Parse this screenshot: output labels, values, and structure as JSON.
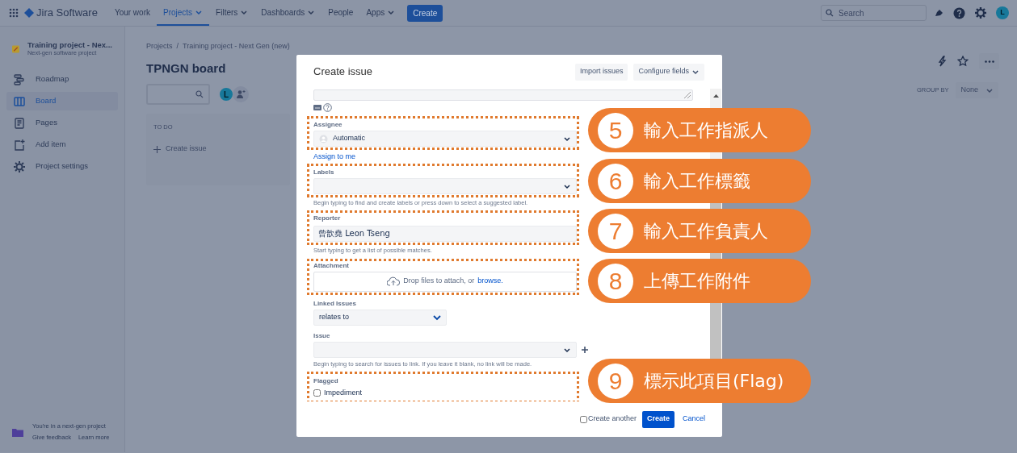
{
  "top_nav": {
    "product": "Jira Software",
    "items": [
      {
        "label": "Your work",
        "selected": false,
        "dropdown": false
      },
      {
        "label": "Projects",
        "selected": true,
        "dropdown": true
      },
      {
        "label": "Filters",
        "selected": false,
        "dropdown": true
      },
      {
        "label": "Dashboards",
        "selected": false,
        "dropdown": true
      },
      {
        "label": "People",
        "selected": false,
        "dropdown": false
      },
      {
        "label": "Apps",
        "selected": false,
        "dropdown": true
      }
    ],
    "create_button": "Create",
    "search": {
      "placeholder": "Search"
    },
    "avatar": "L"
  },
  "sidebar": {
    "project_name": "Training project - Nex...",
    "project_type": "Next-gen software project",
    "items": [
      {
        "label": "Roadmap",
        "selected": false
      },
      {
        "label": "Board",
        "selected": true
      },
      {
        "label": "Pages",
        "selected": false
      },
      {
        "label": "Add item",
        "selected": false
      },
      {
        "label": "Project settings",
        "selected": false
      }
    ],
    "footer": {
      "text": "You're in a next-gen project",
      "links": [
        "Give feedback",
        "Learn more"
      ]
    }
  },
  "board": {
    "breadcrumbs": [
      "Projects",
      "Training project - Next Gen (new)"
    ],
    "breadcrumb_separator": "/",
    "title": "TPNGN board",
    "avatar": "L",
    "group_by": {
      "label": "GROUP BY",
      "value": "None"
    },
    "columns": [
      {
        "title": "TO DO",
        "action": "Create issue"
      }
    ]
  },
  "modal": {
    "title": "Create issue",
    "header_buttons": [
      "Import issues",
      "Configure fields"
    ],
    "assignee": {
      "label": "Assignee",
      "value": "Automatic",
      "link": "Assign to me",
      "highlighted": true
    },
    "labels": {
      "label": "Labels",
      "hint": "Begin typing to find and create labels or press down to select a suggested label.",
      "highlighted": true
    },
    "reporter": {
      "label": "Reporter",
      "value": "曾歆堯 Leon Tseng",
      "hint": "Start typing to get a list of possible matches.",
      "highlighted": true
    },
    "attachment": {
      "label": "Attachment",
      "text": "Drop files to attach, or",
      "link": "browse.",
      "highlighted": true
    },
    "linked_issues": {
      "label": "Linked Issues",
      "value": "relates to"
    },
    "issue": {
      "label": "Issue",
      "hint": "Begin typing to search for issues to link. If you leave it blank, no link will be made."
    },
    "flagged": {
      "label": "Flagged",
      "option": "Impediment",
      "checked": false,
      "highlighted": true
    },
    "footer": {
      "create_another": "Create another",
      "create_another_checked": false,
      "create_button": "Create",
      "cancel": "Cancel"
    }
  },
  "callouts": [
    {
      "number": "5",
      "text": "輸入工作指派人"
    },
    {
      "number": "6",
      "text": "輸入工作標籤"
    },
    {
      "number": "7",
      "text": "輸入工作負責人"
    },
    {
      "number": "8",
      "text": "上傳工作附件"
    },
    {
      "number": "9",
      "text": "標示此項目(Flag)"
    }
  ]
}
